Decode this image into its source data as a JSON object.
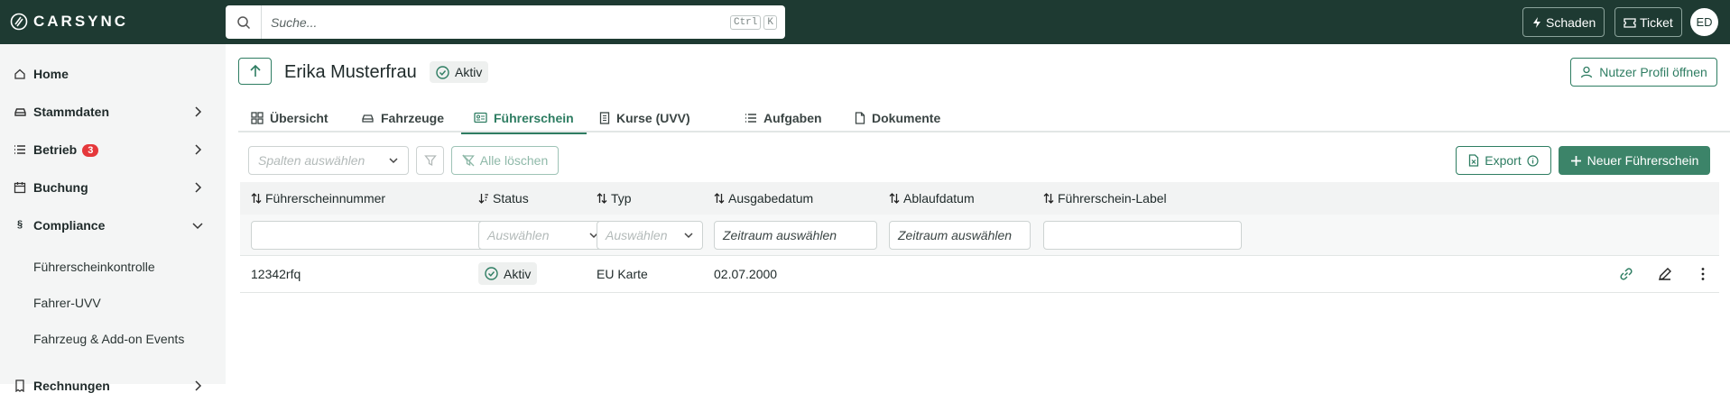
{
  "header": {
    "logo_text": "CARSYNC",
    "search_placeholder": "Suche...",
    "shortcut_keys": [
      "Ctrl",
      "K"
    ],
    "schaden_label": "Schaden",
    "ticket_label": "Ticket",
    "avatar_initials": "ED"
  },
  "sidebar": {
    "items": [
      {
        "label": "Home",
        "icon": "home-icon"
      },
      {
        "label": "Stammdaten",
        "icon": "car-icon"
      },
      {
        "label": "Betrieb",
        "icon": "list-icon",
        "badge": "3"
      },
      {
        "label": "Buchung",
        "icon": "calendar-icon"
      },
      {
        "label": "Compliance",
        "icon": "paragraph-icon"
      },
      {
        "label": "Rechnungen",
        "icon": "receipt-icon"
      }
    ],
    "compliance_sub": [
      "Führerscheinkontrolle",
      "Fahrer-UVV",
      "Fahrzeug & Add-on Events"
    ]
  },
  "page": {
    "title": "Erika Musterfrau",
    "status": "Aktiv",
    "profile_button": "Nutzer Profil öffnen"
  },
  "tabs": [
    {
      "label": "Übersicht",
      "icon": "grid-icon"
    },
    {
      "label": "Fahrzeuge",
      "icon": "car-icon"
    },
    {
      "label": "Führerschein",
      "icon": "id-card-icon",
      "active": true
    },
    {
      "label": "Kurse (UVV)",
      "icon": "document-icon"
    },
    {
      "label": "Aufgaben",
      "icon": "list-icon"
    },
    {
      "label": "Dokumente",
      "icon": "file-icon"
    }
  ],
  "toolbar": {
    "columns_placeholder": "Spalten auswählen",
    "clear_label": "Alle löschen",
    "export_label": "Export",
    "new_label": "Neuer Führerschein"
  },
  "table": {
    "columns": [
      "Führerscheinnummer",
      "Status",
      "Typ",
      "Ausgabedatum",
      "Ablaufdatum",
      "Führerschein-Label"
    ],
    "filters": {
      "status_placeholder": "Auswählen",
      "typ_placeholder": "Auswählen",
      "ausgabe_placeholder": "Zeitraum auswählen",
      "ablauf_placeholder": "Zeitraum auswählen"
    },
    "rows": [
      {
        "nummer": "12342rfq",
        "status": "Aktiv",
        "typ": "EU Karte",
        "ausgabedatum": "02.07.2000",
        "ablaufdatum": "",
        "label": ""
      }
    ]
  },
  "colors": {
    "brand": "#1e3a32",
    "accent": "#2e7d62",
    "badge": "#e5383b"
  }
}
